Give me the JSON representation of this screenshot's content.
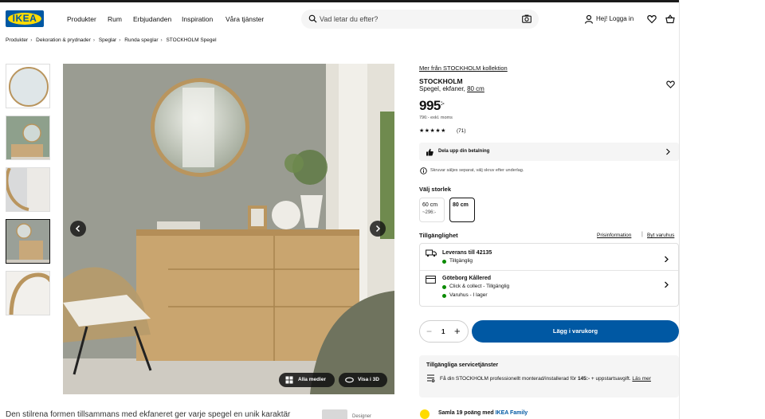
{
  "header": {
    "logo": "IKEA",
    "nav": [
      "Produkter",
      "Rum",
      "Erbjudanden",
      "Inspiration",
      "Våra tjänster"
    ],
    "search_placeholder": "Vad letar du efter?",
    "login": "Hej! Logga in"
  },
  "breadcrumb": [
    "Produkter",
    "Dekoration & prydnader",
    "Speglar",
    "Runda speglar",
    "STOCKHOLM Spegel"
  ],
  "gallery": {
    "media_button": "Alla medier",
    "view3d_button": "Visa i 3D"
  },
  "product": {
    "collection_link": "Mer från STOCKHOLM kollektion",
    "name": "STOCKHOLM",
    "desc_prefix": "Spegel, ekfaner,",
    "desc_size": "80 cm",
    "price": "995",
    "price_suffix": ":-",
    "ex_vat": "796:- exkl. moms",
    "rating_stars": "★★★★★",
    "reviews": "(71)",
    "payment": "Dela upp din betalning",
    "note": "Skruvar säljes separat, välj skruv efter underlag.",
    "size_title": "Välj storlek",
    "sizes": [
      {
        "label": "60 cm",
        "price": "~296:-"
      },
      {
        "label": "80 cm",
        "price": ""
      }
    ]
  },
  "availability": {
    "title": "Tillgänglighet",
    "link_price_info": "Prisinformation",
    "link_store": "Byt varuhus",
    "delivery_title": "Leverans till 42135",
    "delivery_status": "Tillgänglig",
    "store_title": "Göteborg Kållered",
    "store_cc": "Click & collect - Tillgänglig",
    "store_stock": "Varuhus - I lager"
  },
  "cart": {
    "minus": "−",
    "quantity": "1",
    "plus": "+",
    "add": "Lägg i varukorg"
  },
  "services": {
    "title": "Tillgängliga servicetjänster",
    "desc_a": "Få din STOCKHOLM professionellt monterad/installerad för ",
    "desc_price": "145:-",
    "desc_b": " + uppstartsavgift. ",
    "desc_link": "Läs mer"
  },
  "family": {
    "text_a": "Samla 19 poäng med ",
    "text_b": "IKEA Family"
  },
  "bottom": {
    "description": "Den stilrena formen tillsammans med ekfaneret ger varje spegel en unik karaktär",
    "designer": "Designer"
  },
  "colors": {
    "brand_blue": "#0058a3",
    "brand_yellow": "#ffdb00",
    "status_green": "#0a8a00"
  }
}
